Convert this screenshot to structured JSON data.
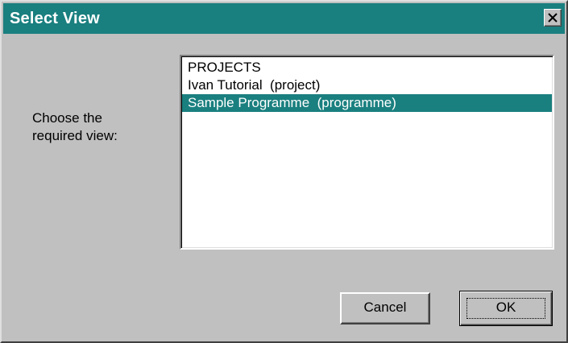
{
  "window": {
    "title": "Select View",
    "title_bar_color": "#1a7f7f",
    "close_icon": "close-icon"
  },
  "prompt": {
    "line1": "Choose the",
    "line2": "required view:"
  },
  "view_list": {
    "items": [
      {
        "label": "PROJECTS",
        "selected": false
      },
      {
        "label": "Ivan Tutorial  (project)",
        "selected": false
      },
      {
        "label": "Sample Programme  (programme)",
        "selected": true
      }
    ],
    "selection_color": "#1a7f7f"
  },
  "buttons": {
    "cancel_label": "Cancel",
    "ok_label": "OK"
  }
}
